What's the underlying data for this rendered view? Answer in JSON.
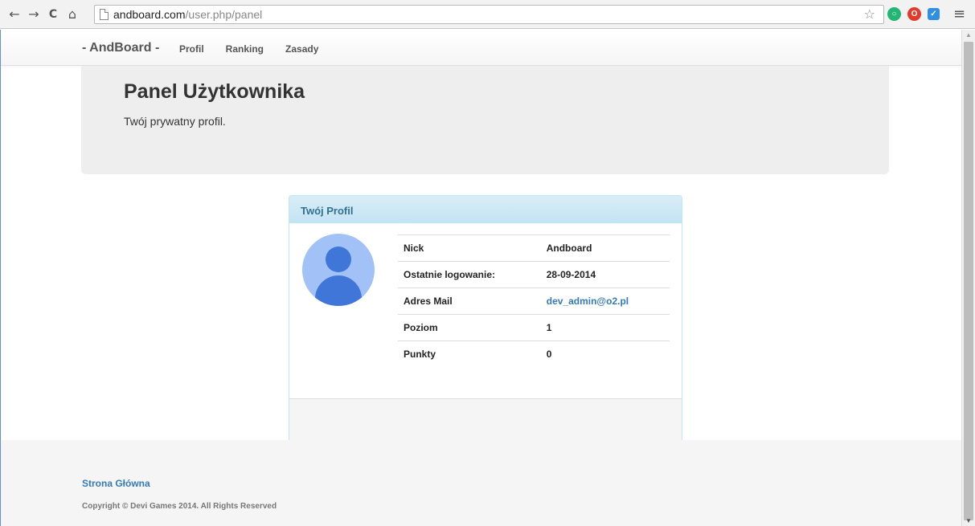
{
  "browser": {
    "url_host": "andboard.com",
    "url_path": "/user.php/panel",
    "back_icon": "←",
    "forward_icon": "→",
    "reload_icon": "C",
    "home_icon": "⌂",
    "star_icon": "☆",
    "menu_icon": "≡"
  },
  "navbar": {
    "brand": "- AndBoard -",
    "links": [
      "Profil",
      "Ranking",
      "Zasady"
    ]
  },
  "jumbotron": {
    "title": "Panel Użytkownika",
    "subtitle": "Twój prywatny profil."
  },
  "panel": {
    "heading": "Twój Profil",
    "rows": [
      {
        "label": "Nick",
        "value": "Andboard"
      },
      {
        "label": "Ostatnie logowanie:",
        "value": "28-09-2014"
      },
      {
        "label": "Adres Mail",
        "value": "dev_admin@o2.pl"
      },
      {
        "label": "Poziom",
        "value": "1"
      },
      {
        "label": "Punkty",
        "value": "0"
      }
    ]
  },
  "footer": {
    "link": "Strona Główna",
    "copyright": "Copyright © Devi Games 2014. All Rights Reserved"
  },
  "colors": {
    "link": "#337ab7",
    "panel_heading_text": "#31708f",
    "avatar_bg": "#a1c1f7",
    "avatar_fg": "#3f76d8"
  }
}
